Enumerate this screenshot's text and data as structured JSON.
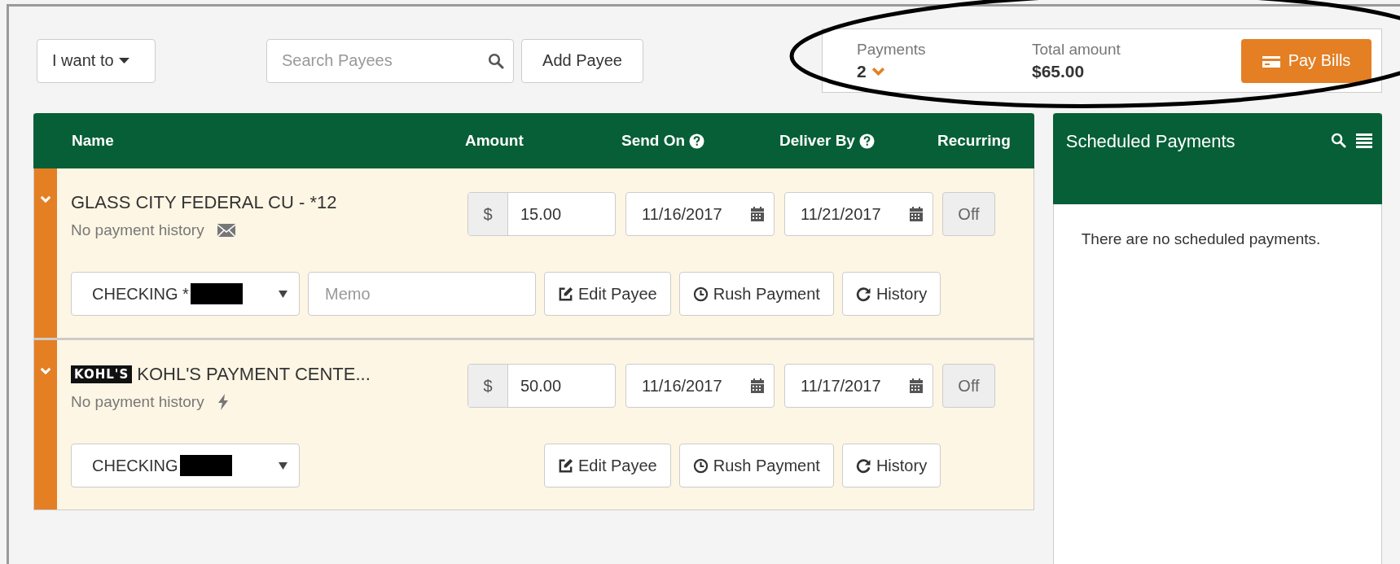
{
  "toolbar": {
    "menu_button": "I want to",
    "search": {
      "placeholder": "Search Payees"
    },
    "add_button": "Add Payee"
  },
  "summary": {
    "payments_label": "Payments",
    "payments_count": "2",
    "total_label": "Total amount",
    "total": "$65.00",
    "pay_button": "Pay Bills"
  },
  "table": {
    "columns": [
      {
        "label": "Name",
        "help": false
      },
      {
        "label": "Amount",
        "help": false
      },
      {
        "label": "Send On",
        "help": true
      },
      {
        "label": "Deliver By",
        "help": true
      },
      {
        "label": "Recurring",
        "help": false
      }
    ],
    "rows": [
      {
        "name": "GLASS CITY FEDERAL CU - *12",
        "history": "No payment history",
        "history_icon": {
          "kind": "mail"
        },
        "currency": "$",
        "amount": "15.00",
        "send_on": "11/16/2017",
        "deliver_by": "11/21/2017",
        "recurring": "Off",
        "account": "CHECKING *",
        "memo": {
          "placeholder": "Memo"
        },
        "buttons": [
          {
            "kind": "edit",
            "label": "Edit Payee"
          },
          {
            "kind": "clock",
            "label": "Rush Payment"
          },
          {
            "kind": "refresh",
            "label": "History"
          }
        ]
      },
      {
        "logo": "KOHL'S",
        "name": "KOHL'S PAYMENT CENTE...",
        "history": "No payment history",
        "history_icon": {
          "kind": "electronic"
        },
        "currency": "$",
        "amount": "50.00",
        "send_on": "11/16/2017",
        "deliver_by": "11/17/2017",
        "recurring": "Off",
        "account": "CHECKING",
        "buttons": [
          {
            "kind": "edit",
            "label": "Edit Payee"
          },
          {
            "kind": "clock",
            "label": "Rush Payment"
          },
          {
            "kind": "refresh",
            "label": "History"
          }
        ]
      }
    ]
  },
  "scheduled": {
    "title": "Scheduled Payments",
    "empty_message": "There are no scheduled payments."
  }
}
